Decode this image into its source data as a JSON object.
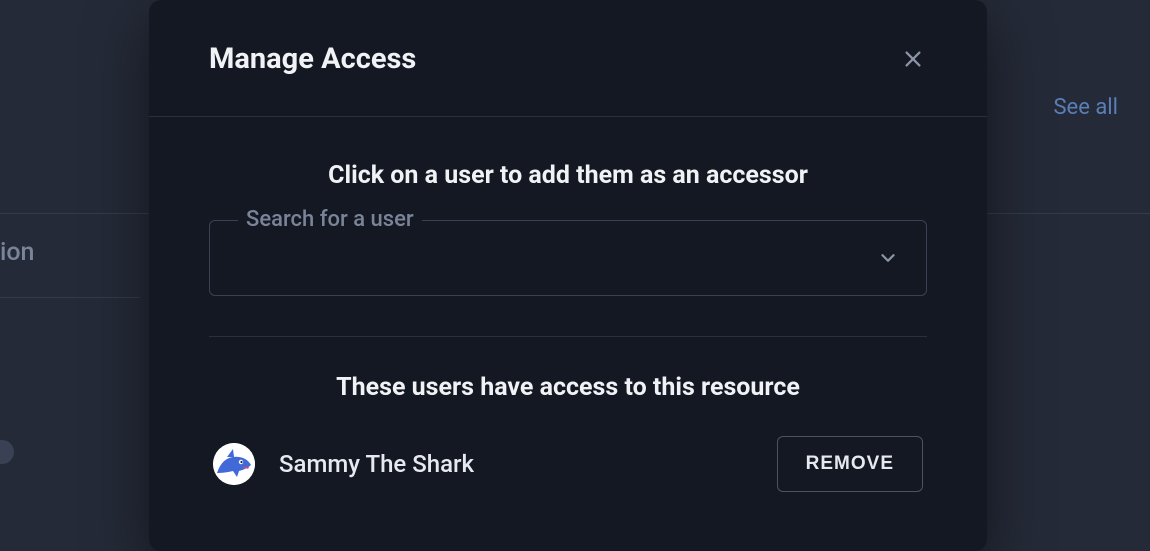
{
  "background": {
    "see_all": "See all",
    "left_fragment": "ion"
  },
  "modal": {
    "title": "Manage Access",
    "add_prompt": "Click on a user to add them as an accessor",
    "search_label": "Search for a user",
    "search_value": "",
    "access_heading": "These users have access to this resource",
    "users": [
      {
        "name": "Sammy The Shark"
      }
    ],
    "remove_label": "REMOVE"
  }
}
